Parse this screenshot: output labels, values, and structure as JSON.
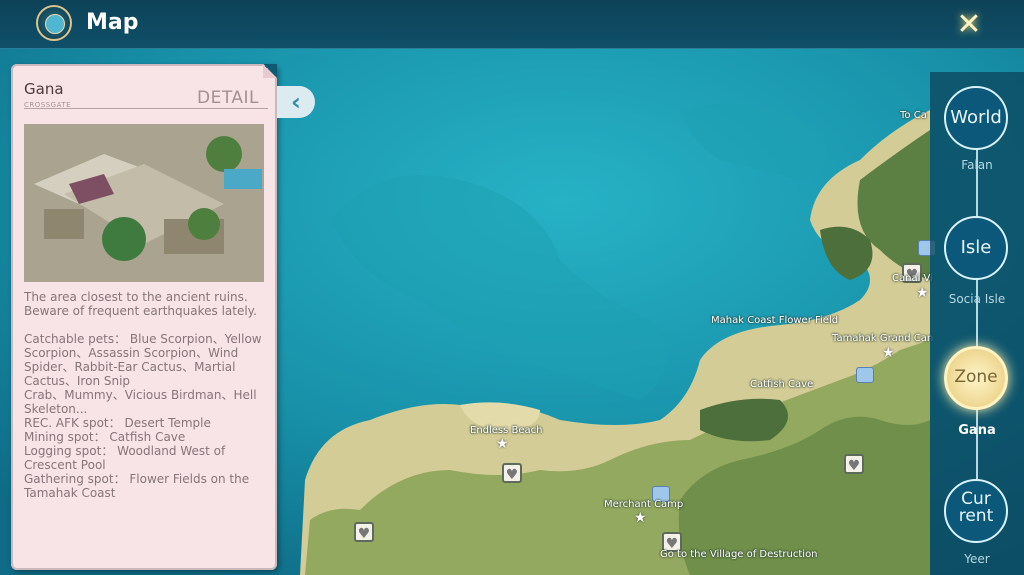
{
  "header": {
    "title": "Map",
    "close_label": "✕"
  },
  "info_panel": {
    "zone_name": "Gana",
    "zone_subtitle": "CROSSGATE",
    "detail_label": "DETAIL",
    "description": "The area closest to the ancient ruins.\nBeware of frequent earthquakes lately.\n\nCatchable pets： Blue Scorpion、Yellow\nScorpion、Assassin Scorpion、Wind\nSpider、Rabbit-Ear Cactus、Martial\nCactus、Iron Snip\nCrab、Mummy、Vicious Birdman、Hell\nSkeleton...\nREC. AFK spot： Desert Temple\nMining spot： Catfish Cave\nLogging spot： Woodland West of\nCrescent Pool\nGathering spot： Flower Fields on the\nTamahak Coast",
    "collapse_icon": "‹"
  },
  "map_labels": {
    "to_ca": "To Ca",
    "canal_vi": "Canal Vi",
    "mahak_coast": "Mahak Coast Flower Field",
    "tamahak_grand": "Tamahak Grand Can",
    "catfish_cave": "Catfish Cave",
    "endless_beach": "Endless Beach",
    "merchant_camp": "Merchant Camp",
    "village_destruction": "Go to the Village of Destruction"
  },
  "levels": [
    {
      "label1": "World",
      "label2": "",
      "sub": "Falan",
      "active": false
    },
    {
      "label1": "Isle",
      "label2": "",
      "sub": "Socia Isle",
      "active": false
    },
    {
      "label1": "Zone",
      "label2": "",
      "sub": "Gana",
      "active": true
    },
    {
      "label1": "Cur",
      "label2": "rent",
      "sub": "Yeer",
      "active": false
    }
  ],
  "colors": {
    "sea": "#1ea0b7",
    "land_sand": "#d3cc96",
    "land_green": "#5f8a4d",
    "active_gold": "#e6c978"
  }
}
